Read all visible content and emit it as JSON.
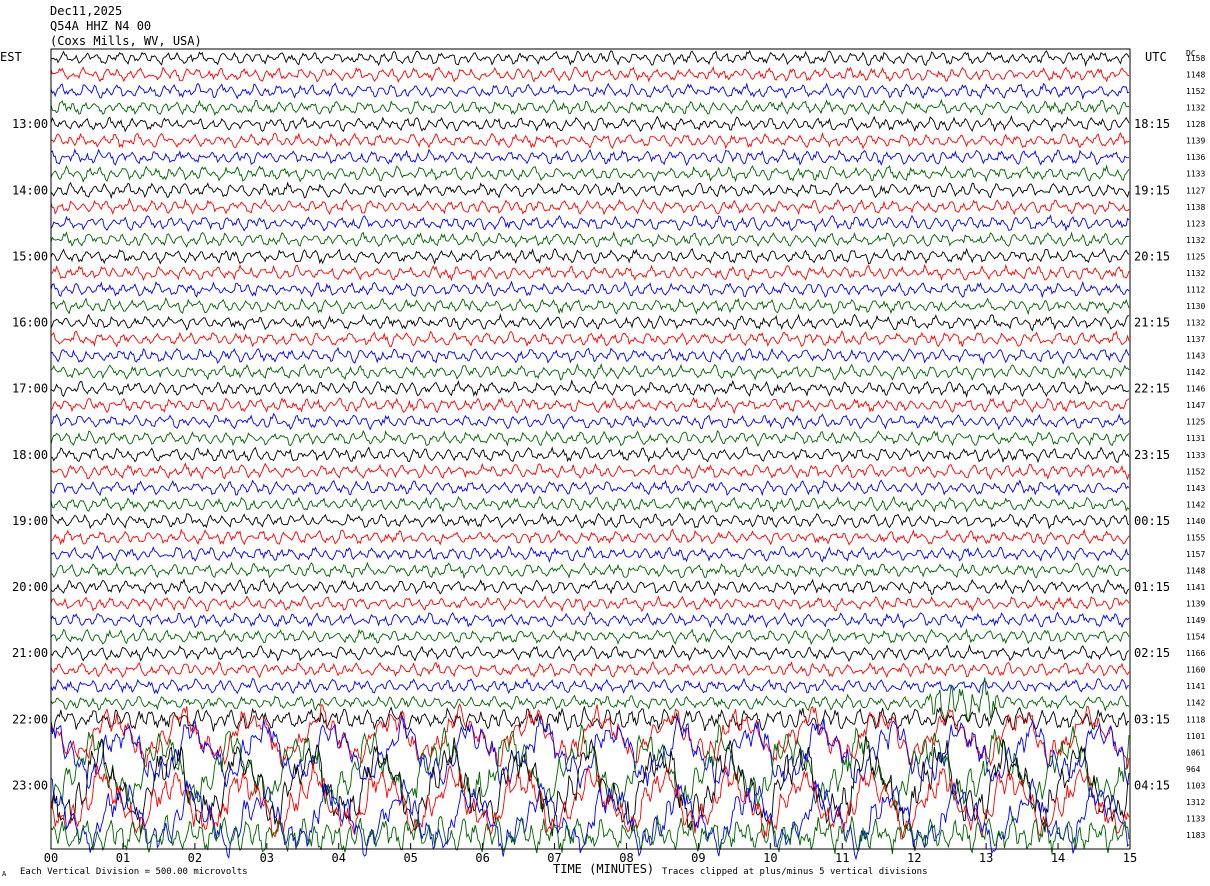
{
  "header": {
    "date": "Dec11,2025",
    "station": "Q54A HHZ N4 00",
    "location": "(Coxs Mills, WV, USA)"
  },
  "corners": {
    "left_zone": "EST",
    "right_zone": "UTC",
    "dc_label": "DC"
  },
  "footer": {
    "scale_note": "Each Vertical Division =  500.00 microvolts",
    "clip_note": "Traces clipped at plus/minus 5 vertical divisions",
    "mark": "A"
  },
  "colors": {
    "trace_cycle": [
      "#000000",
      "#ff0000",
      "#0000ff",
      "#006400"
    ],
    "background": "#ffffff"
  },
  "chart_data": {
    "type": "line",
    "title": "Q54A HHZ N4 00",
    "xlabel": "TIME (MINUTES)",
    "ylabel": "",
    "x_ticks": [
      "00",
      "01",
      "02",
      "03",
      "04",
      "05",
      "06",
      "07",
      "08",
      "09",
      "10",
      "11",
      "12",
      "13",
      "14",
      "15"
    ],
    "xlim": [
      0,
      15
    ],
    "rows_per_hour": 4,
    "row_minutes": 15,
    "left_hour_labels": [
      "13:00",
      "14:00",
      "15:00",
      "16:00",
      "17:00",
      "18:00",
      "19:00",
      "20:00",
      "21:00",
      "22:00",
      "23:00"
    ],
    "right_hour_labels": [
      "18:15",
      "19:15",
      "20:15",
      "21:15",
      "22:15",
      "23:15",
      "00:15",
      "01:15",
      "02:15",
      "03:15",
      "04:15"
    ],
    "dc_offsets": [
      1158,
      1148,
      1152,
      1132,
      1128,
      1139,
      1136,
      1133,
      1127,
      1138,
      1123,
      1132,
      1125,
      1132,
      1112,
      1130,
      1132,
      1137,
      1143,
      1142,
      1146,
      1147,
      1125,
      1131,
      1133,
      1152,
      1143,
      1142,
      1140,
      1155,
      1157,
      1148,
      1141,
      1139,
      1149,
      1154,
      1166,
      1160,
      1141,
      1142,
      1118,
      1101,
      1061,
      964,
      1103,
      1312,
      1133,
      1183
    ],
    "clip_divisions": 5,
    "microvolts_per_division": 500.0
  }
}
